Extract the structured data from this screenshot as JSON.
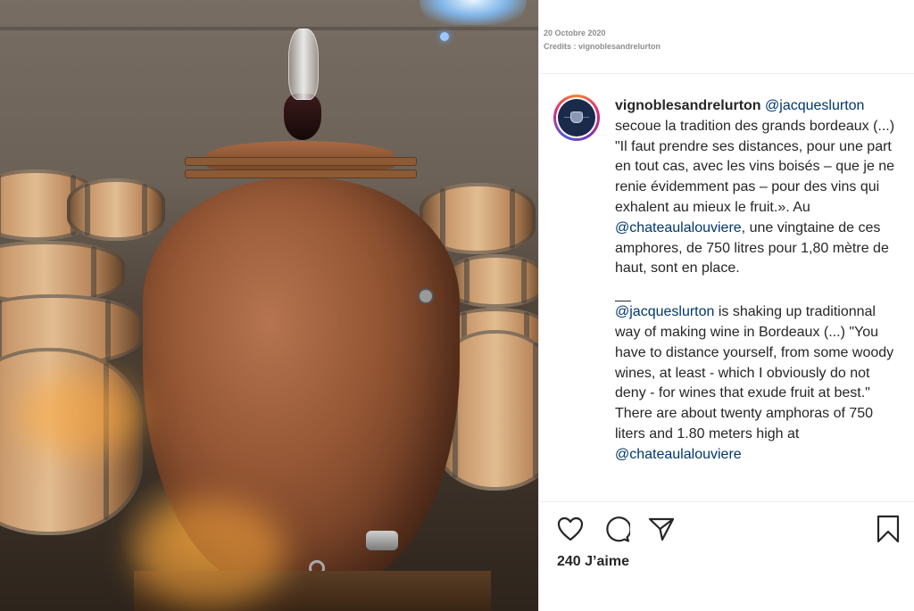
{
  "post": {
    "date": "20 Octobre 2020",
    "credits": "Credits : vignoblesandrelurton",
    "caption": {
      "username": "vignoblesandrelurton",
      "fr_mention": "@jacqueslurton",
      "fr_text_1": " secoue la tradition des grands bordeaux (...) \"Il faut prendre ses distances, pour une part en tout cas, avec les vins boisés – que je ne renie évidemment pas – pour des vins qui exhalent au mieux le fruit.». Au ",
      "fr_mention_2": "@chateaulalouviere",
      "fr_text_2": ", une vingtaine de ces amphores, de 750 litres pour 1,80 mètre de haut, sont en place.",
      "separator": "__",
      "en_mention": "@jacqueslurton",
      "en_text_1": " is shaking up traditionnal way of making wine in Bordeaux (...) \"You have to distance yourself, from some woody wines, at least - which I obviously do not deny - for wines that exude fruit at best.\" There are about twenty amphoras of 750 liters and 1.80 meters high at ",
      "en_mention_2": "@chateaulalouviere"
    },
    "likes_count": "240",
    "likes_label": "J’aime"
  },
  "icons": {
    "like": "heart-icon",
    "comment": "comment-icon",
    "share": "share-icon",
    "save": "bookmark-icon"
  },
  "colors": {
    "mention": "#00376b",
    "text": "#262626",
    "meta": "#8e8e8e"
  }
}
